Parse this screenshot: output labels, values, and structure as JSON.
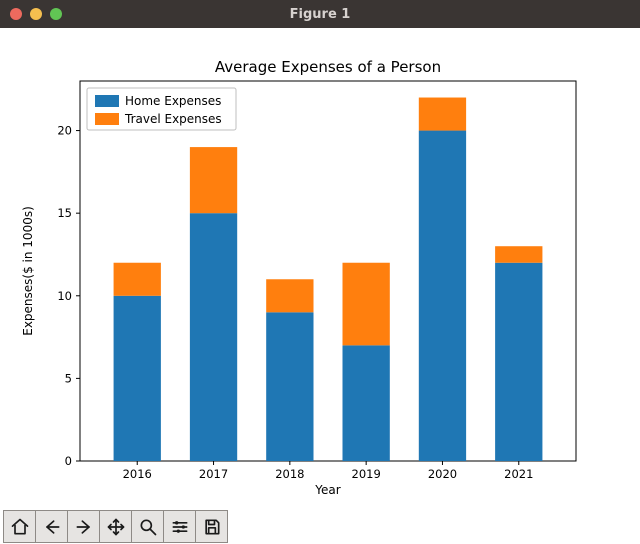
{
  "window": {
    "title": "Figure 1"
  },
  "chart_data": {
    "type": "bar",
    "stacked": true,
    "title": "Average Expenses of a Person",
    "xlabel": "Year",
    "ylabel": "Expenses($ in 1000s)",
    "categories": [
      "2016",
      "2017",
      "2018",
      "2019",
      "2020",
      "2021"
    ],
    "series": [
      {
        "name": "Home Expenses",
        "color": "#1f77b4",
        "values": [
          10,
          15,
          9,
          7,
          20,
          12
        ]
      },
      {
        "name": "Travel Expenses",
        "color": "#ff7f0e",
        "values": [
          2,
          4,
          2,
          5,
          2,
          1
        ]
      }
    ],
    "ylim": [
      0,
      23
    ],
    "yticks": [
      0,
      5,
      10,
      15,
      20
    ],
    "legend_position": "upper-left"
  },
  "toolbar": {
    "items": [
      {
        "name": "home-icon",
        "label": "Home"
      },
      {
        "name": "back-icon",
        "label": "Back"
      },
      {
        "name": "forward-icon",
        "label": "Forward"
      },
      {
        "name": "pan-icon",
        "label": "Pan"
      },
      {
        "name": "zoom-icon",
        "label": "Zoom"
      },
      {
        "name": "config-icon",
        "label": "Configure subplots"
      },
      {
        "name": "save-icon",
        "label": "Save"
      }
    ]
  }
}
